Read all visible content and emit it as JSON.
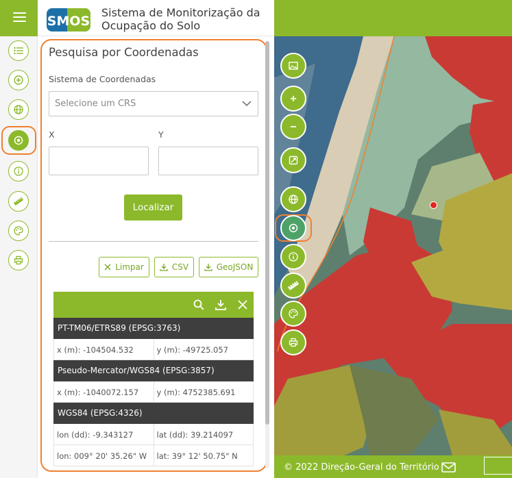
{
  "app": {
    "logo_text": "SMOS",
    "title_line1": "Sistema de Monitorização da",
    "title_line2": "Ocupação do Solo"
  },
  "rail": {
    "items": [
      {
        "icon": "list-icon"
      },
      {
        "icon": "plus-circle-icon"
      },
      {
        "icon": "globe-icon"
      },
      {
        "icon": "target-icon",
        "active": true
      },
      {
        "icon": "info-icon"
      },
      {
        "icon": "ruler-icon"
      },
      {
        "icon": "palette-icon"
      },
      {
        "icon": "print-icon"
      }
    ]
  },
  "panel": {
    "title": "Pesquisa por Coordenadas",
    "crs_label": "Sistema de Coordenadas",
    "crs_placeholder": "Selecione um CRS",
    "x_label": "X",
    "y_label": "Y",
    "locate_label": "Localizar",
    "clear_label": "Limpar",
    "csv_label": "CSV",
    "geojson_label": "GeoJSON"
  },
  "results": {
    "sections": [
      {
        "header": "PT-TM06/ETRS89 (EPSG:3763)",
        "rows": [
          [
            "x (m): -104504.532",
            "y (m): -49725.057"
          ]
        ]
      },
      {
        "header": "Pseudo-Mercator/WGS84 (EPSG:3857)",
        "rows": [
          [
            "x (m): -1040072.157",
            "y (m): 4752385.691"
          ]
        ]
      },
      {
        "header": "WGS84 (EPSG:4326)",
        "rows": [
          [
            "lon (dd): -9.343127",
            "lat (dd): 39.214097"
          ],
          [
            "lon: 009° 20' 35.26\" W",
            "lat: 39° 12' 50.75\" N"
          ]
        ]
      }
    ]
  },
  "map": {
    "toolbar": [
      "image-icon",
      "zoom-in-icon",
      "zoom-out-icon",
      "extent-icon",
      "globe-icon",
      "target-icon",
      "info-icon",
      "ruler-icon",
      "palette-icon",
      "print-icon"
    ],
    "footer_text": "© 2022 Direção-Geral do Território"
  },
  "colors": {
    "accent": "#8cb92b",
    "highlight": "#f08030",
    "dark_row": "#3e3e3e",
    "marker": "#e52421"
  }
}
